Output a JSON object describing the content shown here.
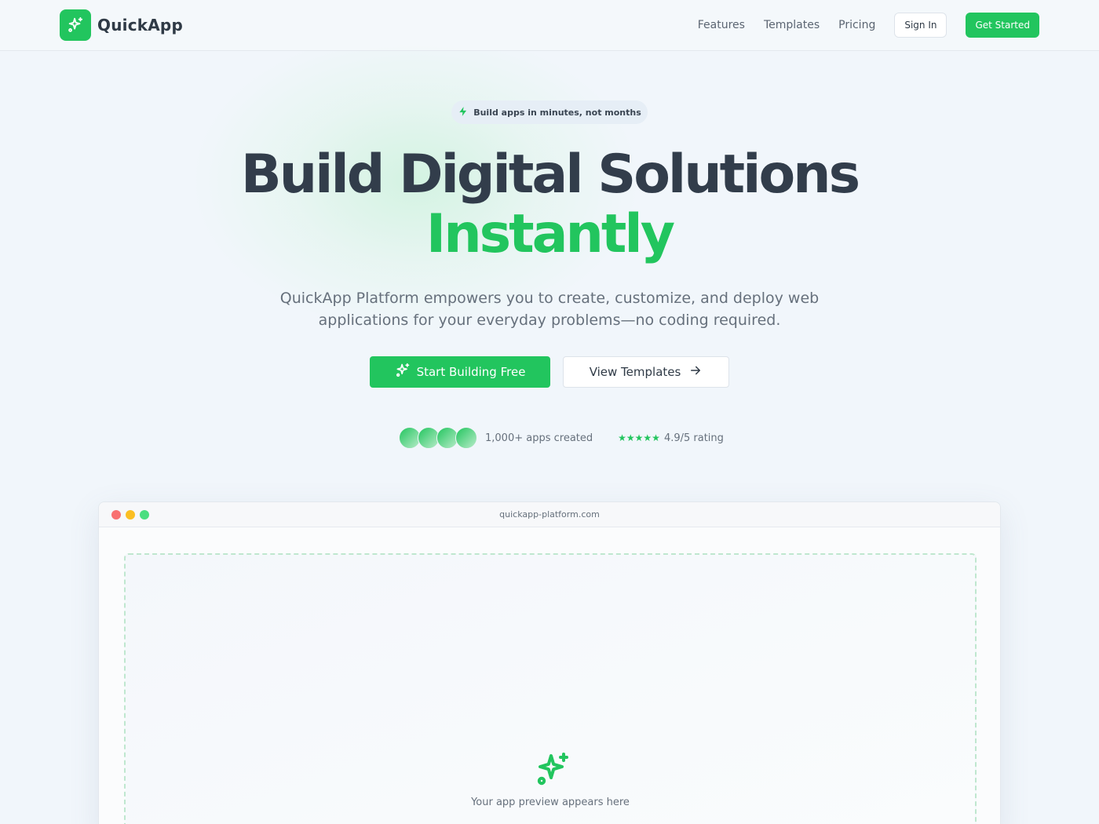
{
  "brand": {
    "name": "QuickApp",
    "icon": "sparkles-icon",
    "color": "#22c55e"
  },
  "nav": {
    "links": [
      "Features",
      "Templates",
      "Pricing"
    ],
    "sign_in": "Sign In",
    "get_started": "Get Started"
  },
  "hero": {
    "badge": {
      "icon": "lightning-icon",
      "text": "Build apps in minutes, not months"
    },
    "title": "Build Digital Solutions",
    "title_accent": "Instantly",
    "subtitle": "QuickApp Platform empowers you to create, customize, and deploy web applications for your everyday problems—no coding required.",
    "primary_cta": {
      "icon": "sparkles-icon",
      "label": "Start Building Free"
    },
    "secondary_cta": {
      "icon": "arrow-right-icon",
      "label": "View Templates"
    },
    "social_proof": {
      "avatar_count": 4,
      "apps_text": "1,000+ apps created",
      "stars": "★★★★★",
      "rating_text": "4.9/5 rating"
    }
  },
  "preview": {
    "url": "quickapp-platform.com",
    "placeholder_icon": "sparkles-icon",
    "placeholder_text": "Your app preview appears here"
  },
  "colors": {
    "accent": "#22c55e",
    "heading": "#323d4b",
    "muted": "#66707c",
    "background": "#f1f6fb"
  }
}
